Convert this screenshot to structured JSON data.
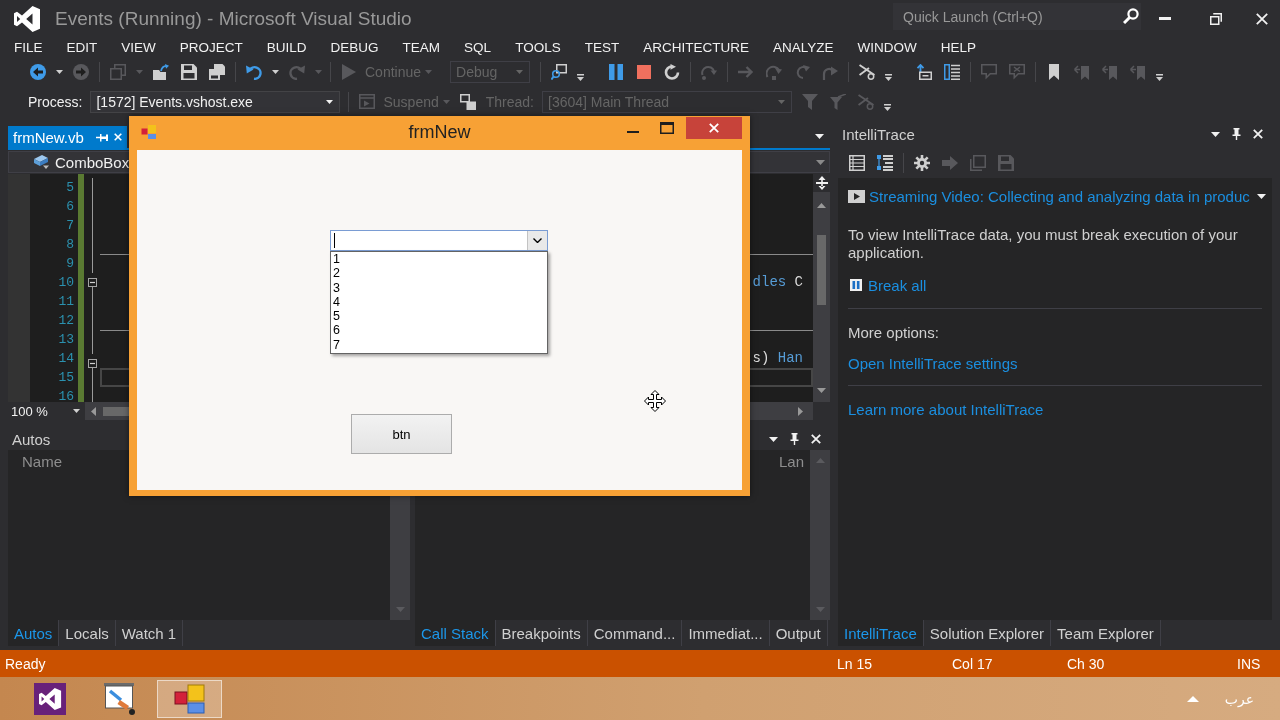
{
  "window": {
    "title": "Events (Running) - Microsoft Visual Studio",
    "quick_launch": {
      "placeholder": "Quick Launch (Ctrl+Q)"
    }
  },
  "menu": [
    "FILE",
    "EDIT",
    "VIEW",
    "PROJECT",
    "BUILD",
    "DEBUG",
    "TEAM",
    "SQL",
    "TOOLS",
    "TEST",
    "ARCHITECTURE",
    "ANALYZE",
    "WINDOW",
    "HELP"
  ],
  "toolbar": [
    {
      "kind": "icon",
      "disabled": false
    },
    {
      "kind": "caret",
      "disabled": false
    },
    {
      "kind": "icon",
      "disabled": true
    },
    {
      "kind": "sep"
    },
    {
      "kind": "icon",
      "disabled": true
    },
    {
      "kind": "caret",
      "disabled": true
    },
    {
      "kind": "icon",
      "disabled": false
    },
    {
      "kind": "icon",
      "disabled": false
    },
    {
      "kind": "icon",
      "disabled": false
    },
    {
      "kind": "sep"
    },
    {
      "kind": "icon",
      "disabled": false
    },
    {
      "kind": "caret",
      "disabled": false
    },
    {
      "kind": "icon",
      "disabled": true
    },
    {
      "kind": "caret",
      "disabled": true
    },
    {
      "kind": "sep"
    },
    {
      "kind": "button",
      "label": "Continue",
      "disabled": true
    },
    {
      "kind": "caret",
      "disabled": true
    },
    {
      "kind": "dropdown",
      "value": "Debug",
      "disabled": true
    },
    {
      "kind": "sep"
    },
    {
      "kind": "icon",
      "disabled": false
    },
    {
      "kind": "overflow"
    },
    {
      "kind": "icon",
      "disabled": false
    },
    {
      "kind": "icon",
      "disabled": false
    },
    {
      "kind": "icon",
      "disabled": false
    },
    {
      "kind": "sep"
    },
    {
      "kind": "icon",
      "disabled": true
    },
    {
      "kind": "sep"
    },
    {
      "kind": "icon",
      "disabled": true
    },
    {
      "kind": "icon",
      "disabled": true
    },
    {
      "kind": "icon",
      "disabled": true
    },
    {
      "kind": "icon",
      "disabled": true
    },
    {
      "kind": "sep"
    },
    {
      "kind": "icon",
      "disabled": false
    },
    {
      "kind": "overflow"
    },
    {
      "kind": "icon",
      "disabled": false
    },
    {
      "kind": "icon",
      "disabled": false
    },
    {
      "kind": "sep"
    },
    {
      "kind": "icon",
      "disabled": true
    },
    {
      "kind": "icon",
      "disabled": true
    },
    {
      "kind": "sep"
    },
    {
      "kind": "icon",
      "disabled": false
    },
    {
      "kind": "icon",
      "disabled": true
    },
    {
      "kind": "icon",
      "disabled": true
    },
    {
      "kind": "icon",
      "disabled": true
    },
    {
      "kind": "overflow"
    }
  ],
  "debug_location_toolbar": [
    {
      "kind": "label",
      "text": "Process:",
      "disabled": false
    },
    {
      "kind": "dropdown",
      "value": "[1572] Events.vshost.exe",
      "disabled": false
    },
    {
      "kind": "sep"
    },
    {
      "kind": "button",
      "label": "Suspend",
      "disabled": true
    },
    {
      "kind": "caret",
      "disabled": true
    },
    {
      "kind": "icon",
      "disabled": false
    },
    {
      "kind": "label",
      "text": "Thread:",
      "disabled": true
    },
    {
      "kind": "dropdown",
      "value": "[3604] Main Thread",
      "disabled": true
    },
    {
      "kind": "icon",
      "disabled": true
    },
    {
      "kind": "icon",
      "disabled": true
    },
    {
      "kind": "icon",
      "disabled": true
    },
    {
      "kind": "overflow"
    }
  ],
  "editor": {
    "tab": {
      "label": "frmNew.vb",
      "selected": true
    },
    "navigation": {
      "value": "ComboBox"
    },
    "lines": [
      {
        "number": "5",
        "collapsible": false,
        "separator": false,
        "current": false
      },
      {
        "number": "6",
        "collapsible": false,
        "separator": false,
        "current": false
      },
      {
        "number": "7",
        "collapsible": false,
        "separator": false,
        "current": false
      },
      {
        "number": "8",
        "collapsible": false,
        "separator": false,
        "current": false
      },
      {
        "number": "9",
        "collapsible": false,
        "separator": true,
        "current": false
      },
      {
        "number": "10",
        "collapsible": true,
        "separator": false,
        "current": false,
        "code": [
          {
            "kind": "keyword",
            "text": "dles"
          },
          {
            "kind": "plain",
            "text": " C"
          }
        ]
      },
      {
        "number": "11",
        "collapsible": false,
        "separator": false,
        "current": false
      },
      {
        "number": "12",
        "collapsible": false,
        "separator": false,
        "current": false
      },
      {
        "number": "13",
        "collapsible": false,
        "separator": true,
        "current": false
      },
      {
        "number": "14",
        "collapsible": true,
        "separator": false,
        "current": false,
        "code": [
          {
            "kind": "plain",
            "text": "s) "
          },
          {
            "kind": "keyword",
            "text": "Han"
          }
        ]
      },
      {
        "number": "15",
        "collapsible": false,
        "separator": false,
        "current": true
      },
      {
        "number": "16",
        "collapsible": false,
        "separator": false,
        "current": false
      }
    ],
    "zoom": "100 %"
  },
  "autos_panel": {
    "title": "Autos",
    "columns": [
      "Name"
    ]
  },
  "call_stack_panel": {
    "columns": [
      "Lan"
    ]
  },
  "bottom_left_tabs": [
    {
      "label": "Autos",
      "selected": true
    },
    {
      "label": "Locals",
      "selected": false
    },
    {
      "label": "Watch 1",
      "selected": false
    }
  ],
  "bottom_right_tabs": [
    {
      "label": "Call Stack",
      "selected": true
    },
    {
      "label": "Breakpoints",
      "selected": false
    },
    {
      "label": "Command...",
      "selected": false
    },
    {
      "label": "Immediat...",
      "selected": false
    },
    {
      "label": "Output",
      "selected": false
    }
  ],
  "intellitrace": {
    "title": "IntelliTrace",
    "toolbar": [
      {
        "kind": "icon",
        "disabled": false
      },
      {
        "kind": "icon",
        "disabled": false
      },
      {
        "kind": "sep"
      },
      {
        "kind": "icon",
        "disabled": false
      },
      {
        "kind": "icon",
        "disabled": true
      },
      {
        "kind": "icon",
        "disabled": true
      },
      {
        "kind": "icon",
        "disabled": true
      }
    ],
    "video_link": "Streaming Video: Collecting and analyzing data in produc",
    "message": "To view IntelliTrace data, you must break execution of your application.",
    "break_all": "Break all",
    "options_label": "More options:",
    "links": [
      "Open IntelliTrace settings",
      "Learn more about IntelliTrace"
    ]
  },
  "side_tabs": [
    {
      "label": "IntelliTrace",
      "selected": true
    },
    {
      "label": "Solution Explorer",
      "selected": false
    },
    {
      "label": "Team Explorer",
      "selected": false
    }
  ],
  "form_window": {
    "title": "frmNew",
    "combo": {
      "focused": true,
      "expanded": true,
      "options": [
        {
          "label": "1",
          "selected": false
        },
        {
          "label": "2",
          "selected": false
        },
        {
          "label": "3",
          "selected": false
        },
        {
          "label": "4",
          "selected": false
        },
        {
          "label": "5",
          "selected": false
        },
        {
          "label": "6",
          "selected": false
        },
        {
          "label": "7",
          "selected": false
        }
      ]
    },
    "button": "btn"
  },
  "status_bar": {
    "message": "Ready",
    "fields": [
      "Ln 15",
      "Col 17",
      "Ch 30",
      "INS"
    ]
  },
  "taskbar": {
    "apps": [
      {
        "selected": false
      },
      {
        "selected": false
      },
      {
        "selected": true
      }
    ],
    "language": "عرب"
  }
}
